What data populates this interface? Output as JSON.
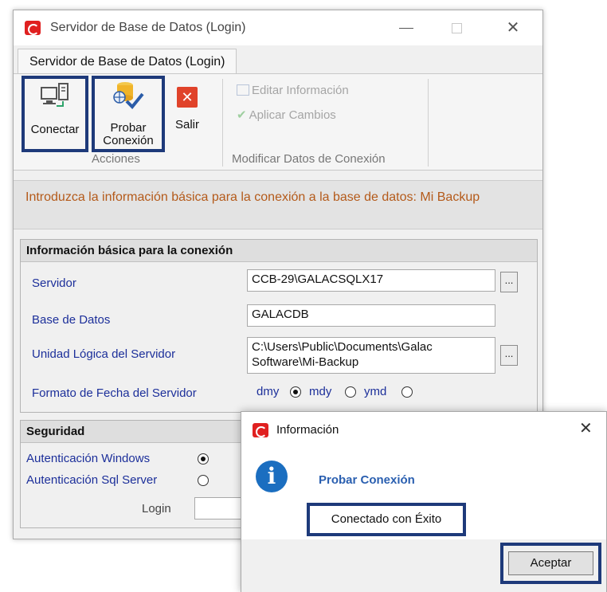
{
  "window": {
    "title": "Servidor de Base de Datos (Login)",
    "close_glyph": "✕"
  },
  "ribbon": {
    "tab_label": "Servidor de Base de Datos (Login)",
    "connect_label": "Conectar",
    "test_label_line1": "Probar",
    "test_label_line2": "Conexión",
    "exit_label": "Salir",
    "actions_group": "Acciones",
    "edit_info": "Editar Información",
    "apply_changes": "Aplicar Cambios",
    "modify_group": "Modificar Datos de Conexión"
  },
  "intro_text": "Introduzca la información básica para la conexión a la base de datos: Mi Backup",
  "connection": {
    "header": "Información básica para la conexión",
    "server_label": "Servidor",
    "server_value": "CCB-29\\GALACSQLX17",
    "database_label": "Base de Datos",
    "database_value": "GALACDB",
    "logical_unit_label": "Unidad Lógica del Servidor",
    "logical_unit_value": "C:\\Users\\Public\\Documents\\Galac Software\\Mi-Backup",
    "date_format_label": "Formato de Fecha del Servidor",
    "date_options": [
      "dmy",
      "mdy",
      "ymd"
    ],
    "date_selected": "dmy",
    "ellipsis": "..."
  },
  "security": {
    "header": "Seguridad",
    "windows_auth": "Autenticación Windows",
    "sql_auth": "Autenticación Sql Server",
    "selected": "Autenticación Windows",
    "login_label": "Login"
  },
  "dialog": {
    "title": "Información",
    "heading": "Probar Conexión",
    "message": "Conectado con Éxito",
    "ok_label": "Aceptar",
    "icon_glyph": "i",
    "close_glyph": "✕"
  },
  "colors": {
    "highlight_border": "#1e3a7a",
    "label_blue": "#1c2f9a",
    "intro_orange": "#b45a1a",
    "logo_red": "#e02020",
    "info_blue": "#1b6ec0"
  }
}
